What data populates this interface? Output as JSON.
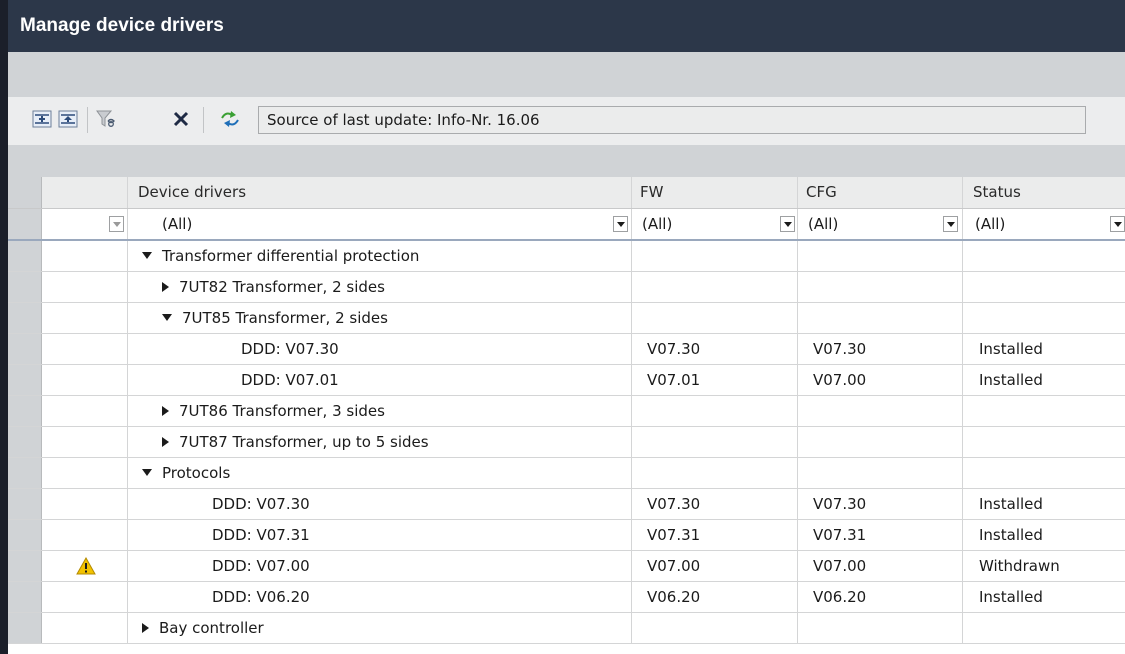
{
  "window": {
    "title": "Manage device drivers"
  },
  "toolbar": {
    "expand_all_icon": "expand-all-icon",
    "collapse_all_icon": "collapse-all-icon",
    "clear_filter_icon": "clear-filter-icon",
    "delete_icon": "delete-icon",
    "update_icon": "update-icon",
    "source_text": "Source of last update: Info-Nr. 16.06"
  },
  "columns": {
    "device": "Device drivers",
    "fw": "FW",
    "cfg": "CFG",
    "status": "Status"
  },
  "filters": {
    "device": "(All)",
    "fw": "(All)",
    "cfg": "(All)",
    "status": "(All)"
  },
  "colors": {
    "title_bar": "#2c3749",
    "warning": "#f2c200",
    "band": "#d0d3d6"
  },
  "rows": [
    {
      "label": "Transformer differential protection",
      "expander": "open",
      "fw": "",
      "cfg": "",
      "status": "",
      "warning": false
    },
    {
      "label": "7UT82 Transformer, 2 sides",
      "expander": "closed",
      "fw": "",
      "cfg": "",
      "status": "",
      "warning": false
    },
    {
      "label": "7UT85 Transformer, 2 sides",
      "expander": "open",
      "fw": "",
      "cfg": "",
      "status": "",
      "warning": false
    },
    {
      "label": "DDD: V07.30",
      "expander": "",
      "fw": "V07.30",
      "cfg": "V07.30",
      "status": "Installed",
      "warning": false
    },
    {
      "label": "DDD: V07.01",
      "expander": "",
      "fw": "V07.01",
      "cfg": "V07.00",
      "status": "Installed",
      "warning": false
    },
    {
      "label": "7UT86 Transformer, 3 sides",
      "expander": "closed",
      "fw": "",
      "cfg": "",
      "status": "",
      "warning": false
    },
    {
      "label": "7UT87 Transformer, up to 5 sides",
      "expander": "closed",
      "fw": "",
      "cfg": "",
      "status": "",
      "warning": false
    },
    {
      "label": "Protocols",
      "expander": "open",
      "fw": "",
      "cfg": "",
      "status": "",
      "warning": false
    },
    {
      "label": "DDD: V07.30",
      "expander": "",
      "fw": "V07.30",
      "cfg": "V07.30",
      "status": "Installed",
      "warning": false
    },
    {
      "label": "DDD: V07.31",
      "expander": "",
      "fw": "V07.31",
      "cfg": "V07.31",
      "status": "Installed",
      "warning": false
    },
    {
      "label": "DDD: V07.00",
      "expander": "",
      "fw": "V07.00",
      "cfg": "V07.00",
      "status": "Withdrawn",
      "warning": true
    },
    {
      "label": "DDD: V06.20",
      "expander": "",
      "fw": "V06.20",
      "cfg": "V06.20",
      "status": "Installed",
      "warning": false
    },
    {
      "label": "Bay controller",
      "expander": "closed",
      "fw": "",
      "cfg": "",
      "status": "",
      "warning": false
    }
  ]
}
